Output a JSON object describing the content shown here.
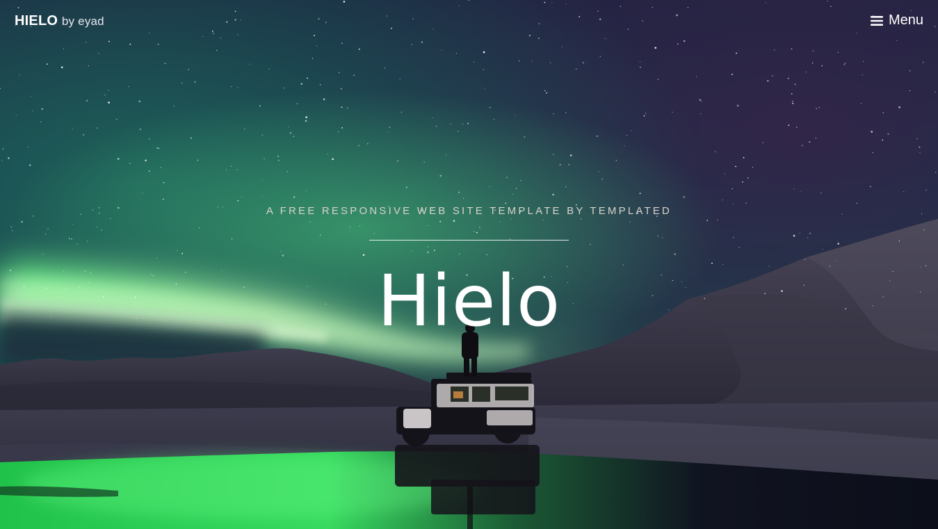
{
  "header": {
    "brand": "HIELO",
    "byline": "by eyad",
    "menu_label": "Menu",
    "menu_icon": "hamburger-icon"
  },
  "hero": {
    "tagline": "A FREE RESPONSIVE WEB SITE TEMPLATE BY TEMPLATED",
    "title": "Hielo",
    "background": "night-sky-aurora-photo"
  },
  "colors": {
    "text": "#ffffff",
    "tagline": "#d9d2cc",
    "aurora": "#5fef7a",
    "sky_top": "#141a3a"
  }
}
